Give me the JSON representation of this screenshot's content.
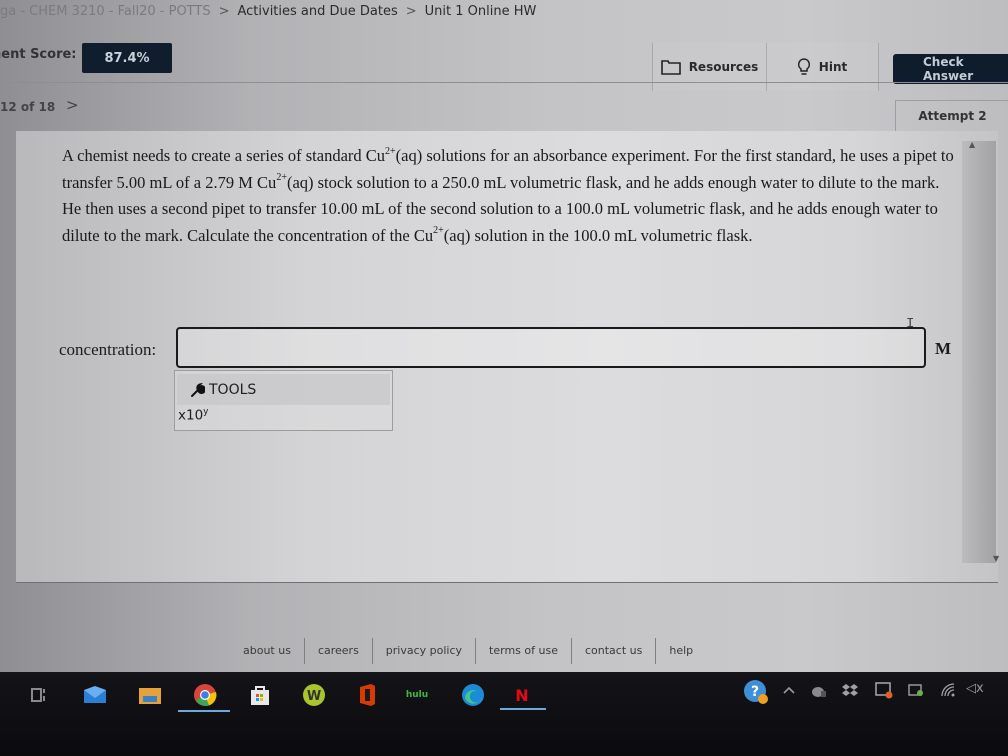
{
  "breadcrumb": {
    "items": [
      "ga - CHEM 3210 - Fall20 - POTTS",
      "Activities and Due Dates",
      "Unit 1 Online HW"
    ],
    "separator": ">"
  },
  "header": {
    "score_label": "nent Score:",
    "score_value": "87.4%",
    "resources_label": "Resources",
    "hint_label": "Hint",
    "check_answer_label": "Check Answer"
  },
  "navigation": {
    "question_counter": "12 of 18",
    "next_icon": ">",
    "attempt_label": "Attempt 2"
  },
  "question": {
    "segments": [
      "A chemist needs to create a series of standard Cu",
      "(aq) solutions for an absorbance experiment. For the first standard, he uses a pipet to transfer 5.00 mL of a 2.79 M Cu",
      "(aq) stock solution to a 250.0 mL volumetric flask, and he adds enough water to dilute to the mark. He then uses a second pipet to transfer 10.00 mL of the second solution to a 100.0 mL volumetric flask, and he adds enough water to dilute to the mark. Calculate the concentration of the Cu",
      "(aq) solution in the 100.0 mL volumetric flask."
    ],
    "ion_charge": "2+"
  },
  "answer": {
    "label": "concentration:",
    "value": "",
    "placeholder": "",
    "unit": "M",
    "cursor_glyph": "I"
  },
  "tools": {
    "header_label": "TOOLS",
    "sci_notation_base": "x10",
    "sci_notation_exp": "y"
  },
  "scrollbar": {
    "up_arrow": "▲",
    "down_arrow": "▼"
  },
  "footer": {
    "links": [
      "about us",
      "careers",
      "privacy policy",
      "terms of use",
      "contact us",
      "help"
    ]
  },
  "taskbar": {
    "apps": [
      "task-view",
      "mail",
      "file-explorer",
      "chrome",
      "microsoft-store",
      "w-app",
      "office",
      "hulu",
      "edge",
      "netflix"
    ],
    "hulu_label": "hulu",
    "netflix_label": "N",
    "tray": [
      "help-icon",
      "chevron-up",
      "onedrive",
      "dropbox",
      "capture",
      "battery",
      "wifi",
      "volume-muted"
    ],
    "volume_glyph": "◁x"
  },
  "colors": {
    "badge_bg": "#0f1d2c",
    "check_answer_bg": "#0e1c2b",
    "taskbar_bg": "#0b0b0e",
    "taskbar_active": "#6fa8dc"
  }
}
